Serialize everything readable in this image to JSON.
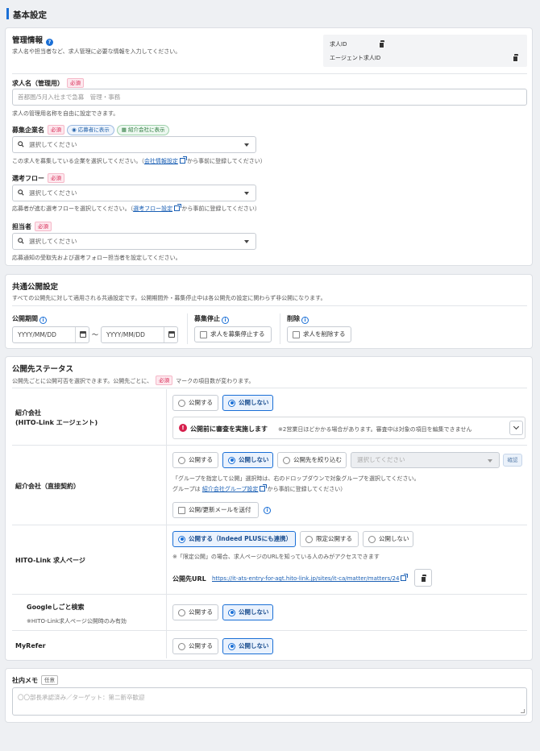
{
  "page": {
    "title": "基本設定"
  },
  "mgmt": {
    "title": "管理情報",
    "desc": "求人名や担当者など、求人管理に必要な情報を入力してください。",
    "job_id_label": "求人ID",
    "agent_job_id_label": "エージェント求人ID",
    "job_name": {
      "label": "求人名（管理用）",
      "required": "必須",
      "placeholder": "首都圏/5月入社まで急募　管理・事務",
      "help": "求人の管理用名称を自由に設定できます。"
    },
    "company": {
      "label": "募集企業名",
      "required": "必須",
      "pill_applicant": "応募者に表示",
      "pill_agency": "紹介会社に表示",
      "placeholder": "選択してください",
      "help_pre": "この求人を募集している企業を選択してください。（",
      "help_link": "会社情報設定",
      "help_post": "から事前に登録してください）"
    },
    "flow": {
      "label": "選考フロー",
      "required": "必須",
      "placeholder": "選択してください",
      "help_pre": "応募者が進む選考フローを選択してください。（",
      "help_link": "選考フロー設定",
      "help_post": "から事前に登録してください）"
    },
    "owner": {
      "label": "担当者",
      "required": "必須",
      "placeholder": "選択してください",
      "help": "応募通知の受取先および選考フォロー担当者を設定してください。"
    }
  },
  "common": {
    "title": "共通公開設定",
    "desc": "すべての公開先に対して適用される共通設定です。公開期間外・募集停止中は各公開先の設定に関わらず非公開になります。",
    "period_label": "公開期間",
    "date_placeholder": "YYYY/MM/DD",
    "tilde": "〜",
    "stop_label": "募集停止",
    "stop_checkbox": "求人を募集停止する",
    "delete_label": "削除",
    "delete_checkbox": "求人を削除する"
  },
  "status": {
    "title": "公開先ステータス",
    "desc_pre": "公開先ごとに公開可否を選択できます。公開先ごとに、",
    "desc_req": "必須",
    "desc_post": "マークの項目数が変わります。",
    "agent": {
      "label_1": "紹介会社",
      "label_2": "(HITO-Link エージェント)",
      "opt_public": "公開する",
      "opt_private": "公開しない",
      "notice": "公開前に審査を実施します",
      "notice_sub": "※2営業日ほどかかる場合があります。審査中は対象の項目を編集できません"
    },
    "direct": {
      "label": "紹介会社（直接契約）",
      "opt_public": "公開する",
      "opt_private": "公開しない",
      "opt_narrow": "公開先を絞り込む",
      "group_placeholder": "選択してください",
      "confirm": "確認",
      "note1": "「グループを指定して公開」選択時は、右のドロップダウンで対象グループを選択してください。",
      "note2_pre": "グループは",
      "note2_link": "紹介会社グループ設定",
      "note2_post": "から事前に登録してください）",
      "mail_checkbox": "公開/更新メールを送付"
    },
    "hitolink": {
      "label": "HITO-Link 求人ページ",
      "opt_public": "公開する（Indeed PLUSにも連携）",
      "opt_limited": "限定公開する",
      "opt_private": "公開しない",
      "note": "※「限定公開」の場合、求人ページのURLを知っている人のみがアクセスできます",
      "url_label": "公開先URL",
      "url": "https://it-ats-entry-for-agt.hito-link.jp/sites/it-ca/matter/matters/24"
    },
    "google": {
      "label": "Googleしごと検索",
      "sub": "※HITO-Link求人ページ公開時のみ有効",
      "opt_public": "公開する",
      "opt_private": "公開しない"
    },
    "myrefer": {
      "label": "MyRefer",
      "opt_public": "公開する",
      "opt_private": "公開しない"
    }
  },
  "memo": {
    "label": "社内メモ",
    "optional": "任意",
    "placeholder": "〇〇部長承認済み／ターゲット：第二新卒歓迎"
  },
  "colors": {
    "accent": "#1a6fd6",
    "required": "#d6204d"
  }
}
